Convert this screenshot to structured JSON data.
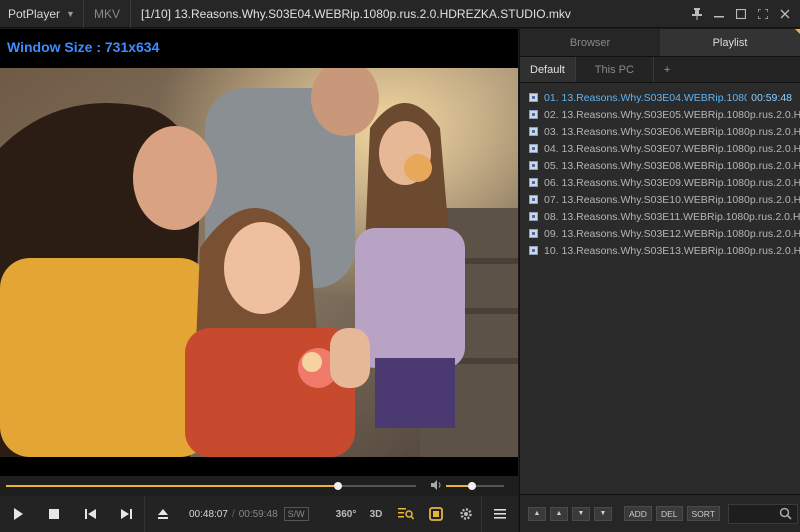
{
  "app": {
    "name": "PotPlayer",
    "format": "MKV",
    "title": "[1/10] 13.Reasons.Why.S03E04.WEBRip.1080p.rus.2.0.HDREZKA.STUDIO.mkv",
    "window_buttons": [
      "pin-icon",
      "minimize-icon",
      "maximize-icon",
      "fullscreen-icon",
      "close-icon"
    ]
  },
  "video": {
    "osd_text": "Window Size : 731x634"
  },
  "seek": {
    "progress": 0.81
  },
  "volume": {
    "level": 0.45
  },
  "playback": {
    "current_time": "00:48:07",
    "separator": "/",
    "total_time": "00:59:48",
    "sw_label": "S/W",
    "label_360": "360°",
    "label_3d": "3D"
  },
  "playlist_panel": {
    "tabs": [
      "Browser",
      "Playlist"
    ],
    "active_tab": "Playlist",
    "subtabs": [
      "Default",
      "This PC",
      "+"
    ],
    "items": [
      {
        "label": "01. 13.Reasons.Why.S03E04.WEBRip.1080p....",
        "duration": "00:59:48",
        "current": true
      },
      {
        "label": "02. 13.Reasons.Why.S03E05.WEBRip.1080p.rus.2.0.H..."
      },
      {
        "label": "03. 13.Reasons.Why.S03E06.WEBRip.1080p.rus.2.0.H..."
      },
      {
        "label": "04. 13.Reasons.Why.S03E07.WEBRip.1080p.rus.2.0.H..."
      },
      {
        "label": "05. 13.Reasons.Why.S03E08.WEBRip.1080p.rus.2.0.H..."
      },
      {
        "label": "06. 13.Reasons.Why.S03E09.WEBRip.1080p.rus.2.0.H..."
      },
      {
        "label": "07. 13.Reasons.Why.S03E10.WEBRip.1080p.rus.2.0.H..."
      },
      {
        "label": "08. 13.Reasons.Why.S03E11.WEBRip.1080p.rus.2.0.H..."
      },
      {
        "label": "09. 13.Reasons.Why.S03E12.WEBRip.1080p.rus.2.0.H..."
      },
      {
        "label": "10. 13.Reasons.Why.S03E13.WEBRip.1080p.rus.2.0.H..."
      }
    ],
    "buttons": {
      "add": "ADD",
      "del": "DEL",
      "sort": "SORT"
    }
  },
  "colors": {
    "accent": "#e7b53a",
    "osd": "#3f8cff",
    "current_item": "#5fb4f2"
  }
}
